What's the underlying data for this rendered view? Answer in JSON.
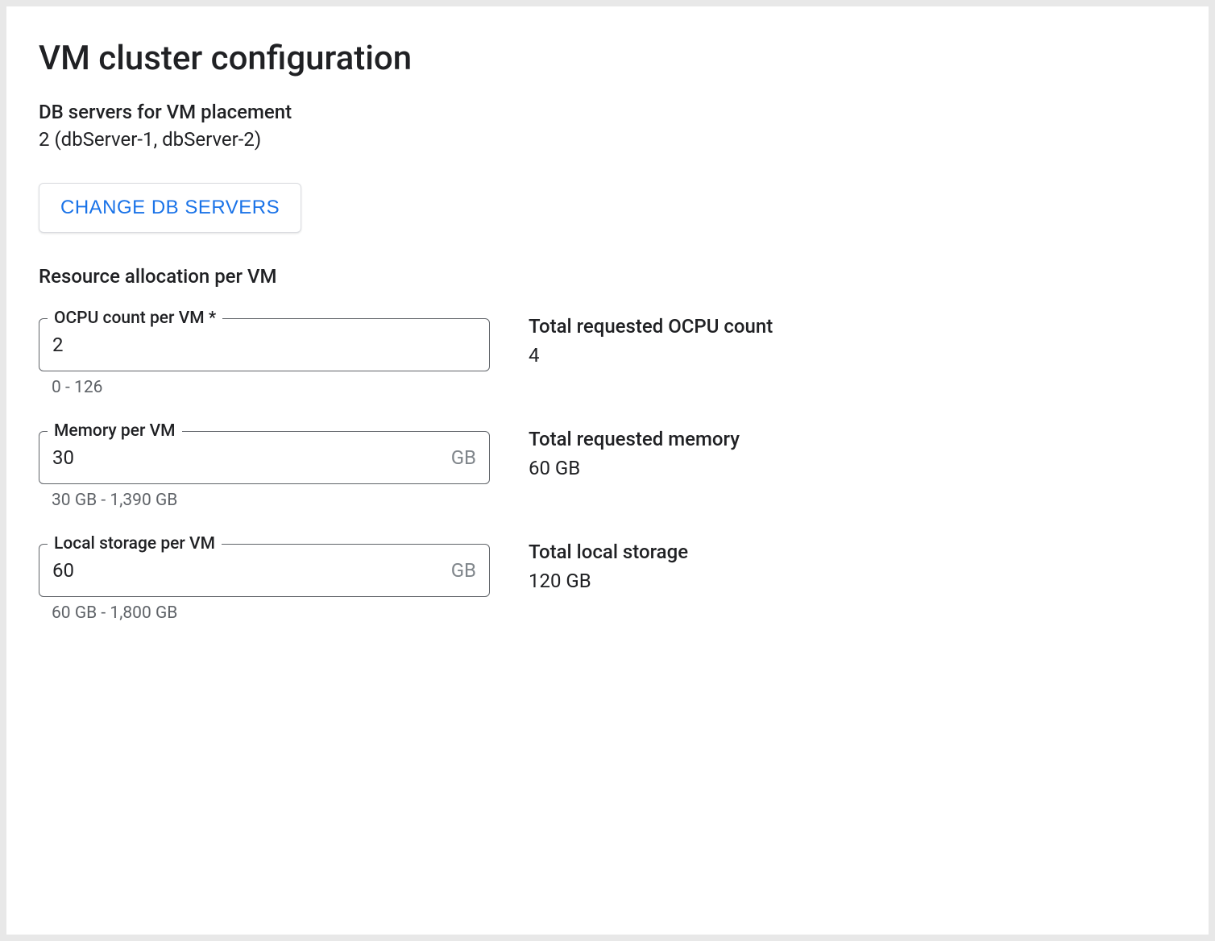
{
  "title": "VM cluster configuration",
  "db_servers": {
    "label": "DB servers for VM placement",
    "value": "2 (dbServer-1, dbServer-2)",
    "change_button": "CHANGE DB SERVERS"
  },
  "resource_section_label": "Resource allocation per VM",
  "fields": {
    "ocpu": {
      "label": "OCPU count per VM *",
      "value": "2",
      "helper": "0 - 126",
      "total_label": "Total requested OCPU count",
      "total_value": "4"
    },
    "memory": {
      "label": "Memory per VM",
      "value": "30",
      "suffix": "GB",
      "helper": "30 GB - 1,390 GB",
      "total_label": "Total requested memory",
      "total_value": "60 GB"
    },
    "storage": {
      "label": "Local storage per VM",
      "value": "60",
      "suffix": "GB",
      "helper": "60 GB - 1,800 GB",
      "total_label": "Total local storage",
      "total_value": "120 GB"
    }
  }
}
